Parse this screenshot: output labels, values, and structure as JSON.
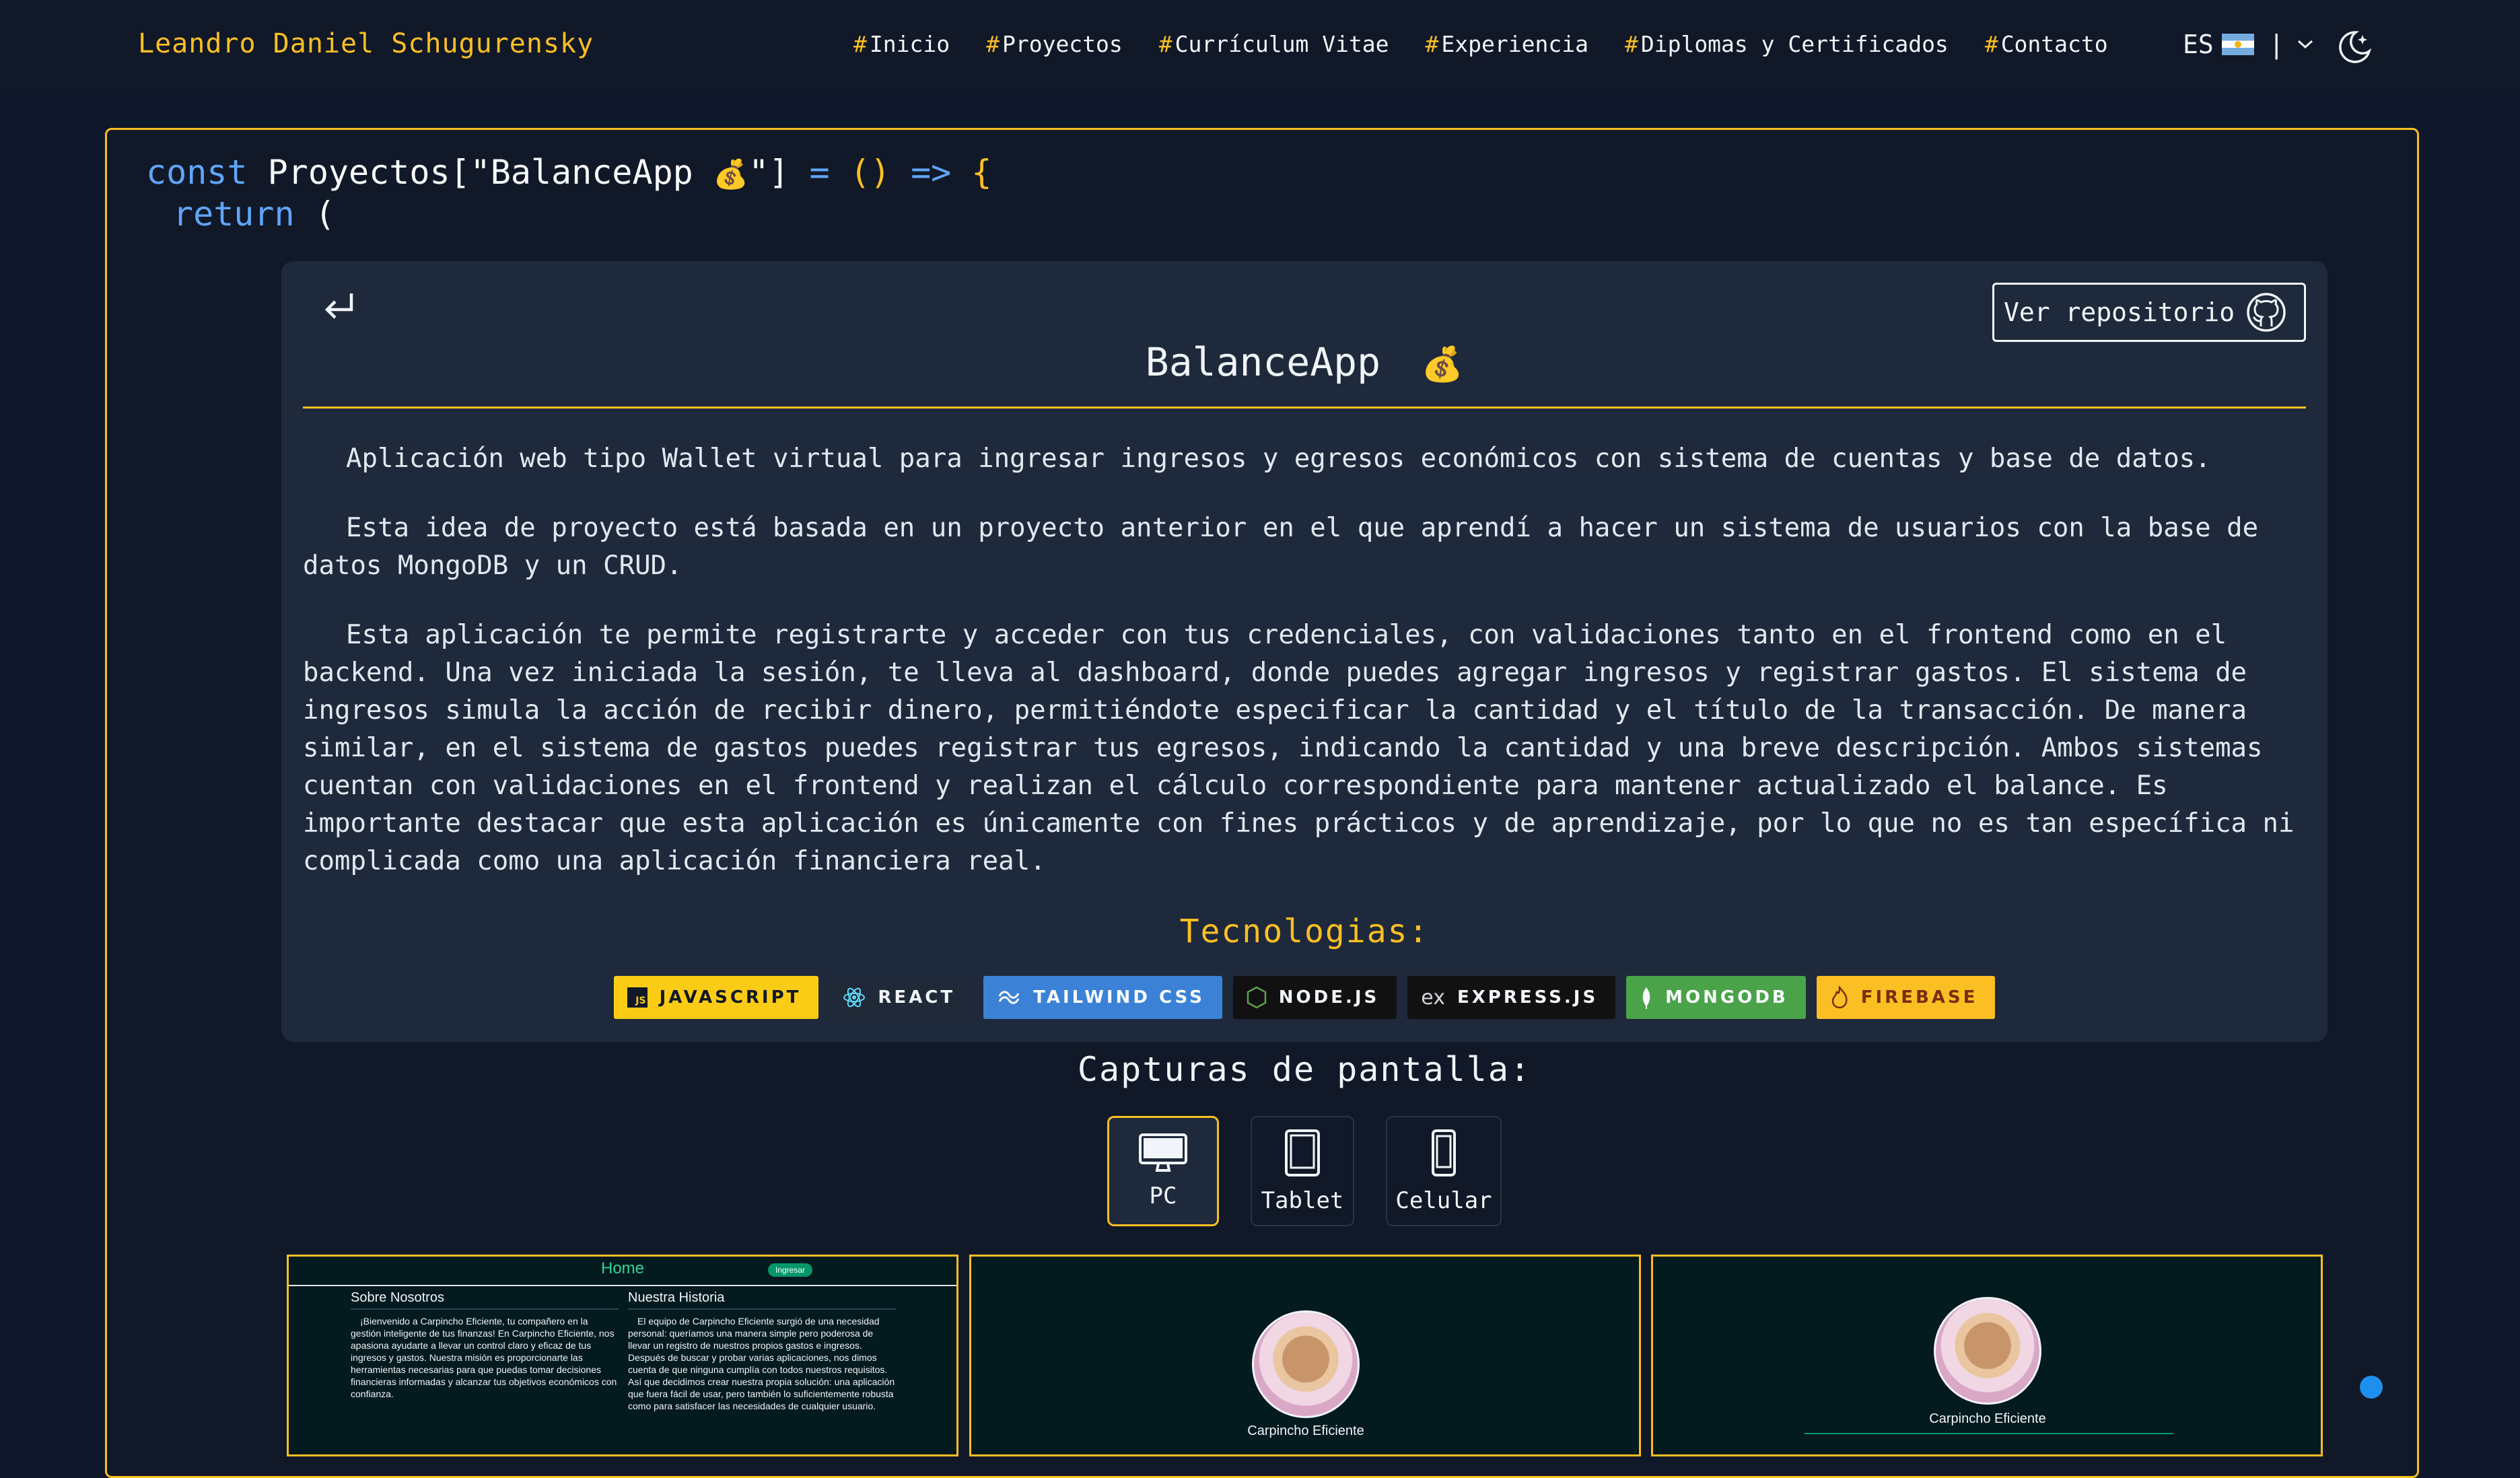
{
  "nav": {
    "brand": "Leandro Daniel Schugurensky",
    "items": [
      {
        "label": "Inicio"
      },
      {
        "label": "Proyectos"
      },
      {
        "label": "Currículum Vitae"
      },
      {
        "label": "Experiencia"
      },
      {
        "label": "Diplomas y Certificados"
      },
      {
        "label": "Contacto"
      }
    ],
    "hash": "#",
    "lang": "ES",
    "separator": "|"
  },
  "code": {
    "kw_const": "const",
    "ident": "Proyectos[\"BalanceApp ",
    "emoji": "💰",
    "ident_end": "\"]",
    "assign": "=",
    "parens": "()",
    "arrow": "=>",
    "brace": "{",
    "kw_return": "return",
    "open_paren": "("
  },
  "project": {
    "repo_button": "Ver repositorio",
    "title": "BalanceApp",
    "title_emoji": "💰",
    "paragraphs": [
      "Aplicación web tipo Wallet virtual para ingresar ingresos y egresos económicos con sistema de cuentas y base de datos.",
      "Esta idea de proyecto está basada en un proyecto anterior en el que aprendí a hacer un sistema de usuarios con la base de datos MongoDB y un CRUD.",
      "Esta aplicación te permite registrarte y acceder con tus credenciales, con validaciones tanto en el frontend como en el backend. Una vez iniciada la sesión, te lleva al dashboard, donde puedes agregar ingresos y registrar gastos. El sistema de ingresos simula la acción de recibir dinero, permitiéndote especificar la cantidad y el título de la transacción. De manera similar, en el sistema de gastos puedes registrar tus egresos, indicando la cantidad y una breve descripción. Ambos sistemas cuentan con validaciones en el frontend y realizan el cálculo correspondiente para mantener actualizado el balance. Es importante destacar que esta aplicación es únicamente con fines prácticos y de aprendizaje, por lo que no es tan específica ni complicada como una aplicación financiera real."
    ],
    "tech_title": "Tecnologias:",
    "badges": [
      {
        "label": "JAVASCRIPT",
        "color": "#facc15"
      },
      {
        "label": "REACT",
        "color": "#1f2937"
      },
      {
        "label": "TAILWIND CSS",
        "color": "#3b82d6"
      },
      {
        "label": "NODE.JS",
        "color": "#111111"
      },
      {
        "label": "EXPRESS.JS",
        "color": "#111111"
      },
      {
        "label": "MONGODB",
        "color": "#4aa348"
      },
      {
        "label": "FIREBASE",
        "color": "#fbbf24"
      }
    ],
    "express_glyph": "ex",
    "js_glyph": "JS"
  },
  "screenshots": {
    "title": "Capturas de pantalla:",
    "devices": [
      {
        "label": "PC",
        "active": true
      },
      {
        "label": "Tablet",
        "active": false
      },
      {
        "label": "Celular",
        "active": false
      }
    ],
    "shot1": {
      "home": "Home",
      "pill": "Ingresar",
      "col1_title": "Sobre Nosotros",
      "col1_text": "¡Bienvenido a Carpincho Eficiente, tu compañero en la gestión inteligente de tus finanzas! En Carpincho Eficiente, nos apasiona ayudarte a llevar un control claro y eficaz de tus ingresos y gastos. Nuestra misión es proporcionarte las herramientas necesarias para que puedas tomar decisiones financieras informadas y alcanzar tus objetivos económicos con confianza.",
      "col2_title": "Nuestra Historia",
      "col2_text": "El equipo de Carpincho Eficiente surgió de una necesidad personal: queríamos una manera simple pero poderosa de llevar un registro de nuestros propios gastos e ingresos. Después de buscar y probar varias aplicaciones, nos dimos cuenta de que ninguna cumplía con todos nuestros requisitos. Así que decidimos crear nuestra propia solución: una aplicación que fuera fácil de usar, pero también lo suficientemente robusta como para satisfacer las necesidades de cualquier usuario."
    },
    "shot2": {
      "name": "Carpincho Eficiente"
    },
    "shot3": {
      "name": "Carpincho Eficiente"
    }
  },
  "colors": {
    "accent": "#fbbf24",
    "background": "#0f172a",
    "panel": "#1e293b",
    "keyword": "#60a5fa"
  }
}
